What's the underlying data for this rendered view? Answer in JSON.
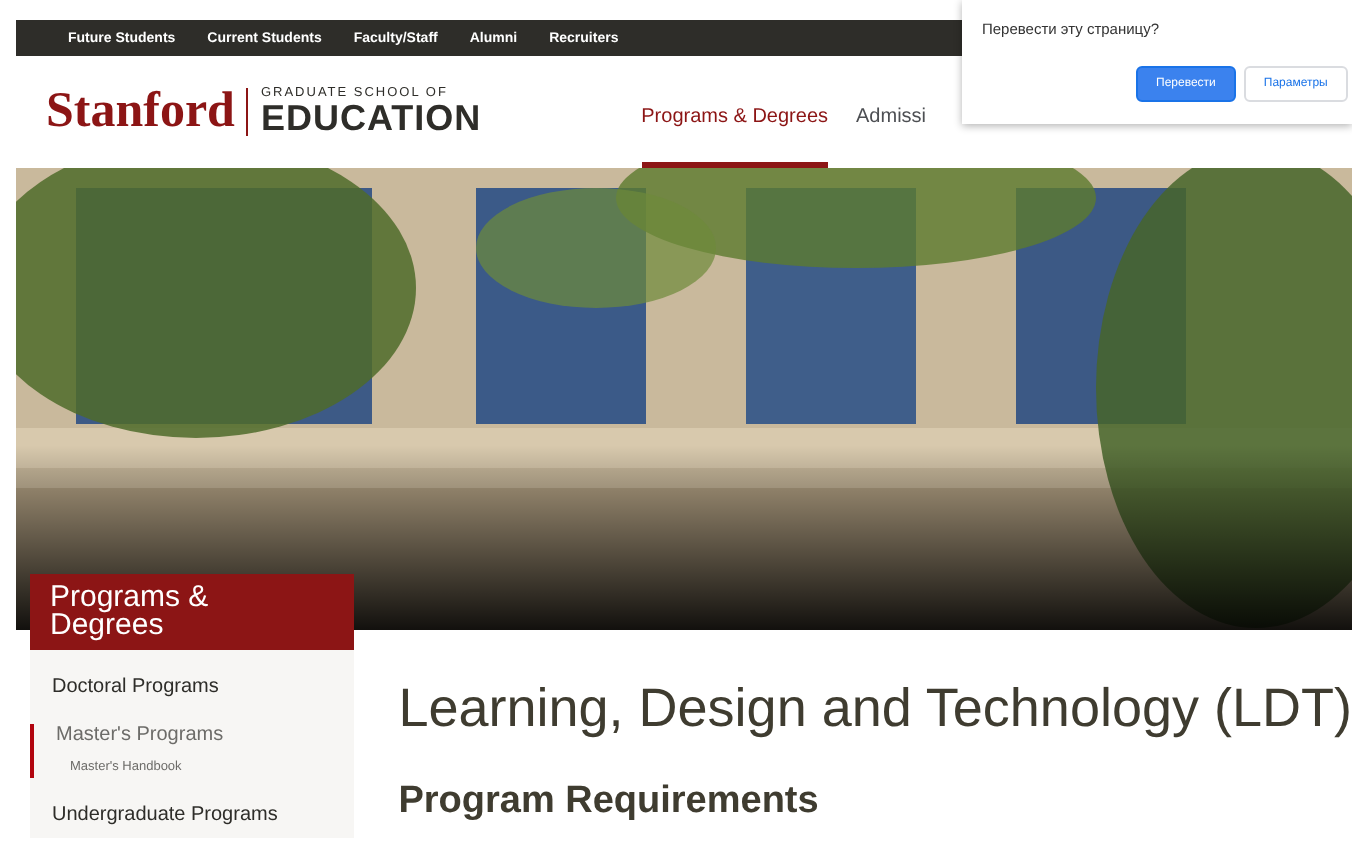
{
  "top_links": [
    "Future Students",
    "Current Students",
    "Faculty/Staff",
    "Alumni",
    "Recruiters"
  ],
  "logo": {
    "wordmark": "Stanford",
    "subtitle": "GRADUATE SCHOOL OF",
    "title": "EDUCATION"
  },
  "nav": [
    {
      "label": "Programs & Degrees",
      "selected": true
    },
    {
      "label": "Admissi",
      "selected": false
    }
  ],
  "translate_popup": {
    "question": "Перевести эту страницу?",
    "buttons": [
      {
        "label": "Перевести",
        "kind": "primary"
      },
      {
        "label": "Параметры",
        "kind": "secondary"
      }
    ]
  },
  "sidebar": {
    "title": "Programs & Degrees",
    "items": [
      {
        "label": "Doctoral Programs",
        "selected": false
      },
      {
        "label": "Master's Programs",
        "selected": true,
        "children": [
          {
            "label": "Master's Handbook",
            "selected": false
          }
        ]
      },
      {
        "label": "Undergraduate Programs",
        "selected": false
      }
    ]
  },
  "page_title": "Learning, Design and Technology (LDT)",
  "section_heading": "Program Requirements"
}
